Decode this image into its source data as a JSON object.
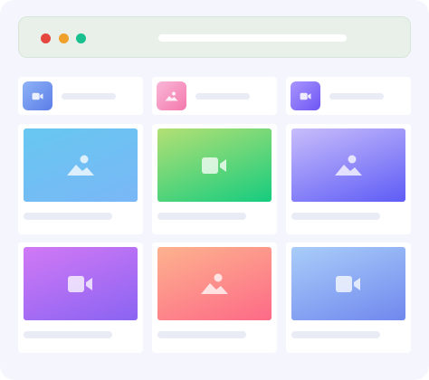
{
  "browser": {
    "traffic_lights": [
      "#e5463e",
      "#f0a12b",
      "#18c08f"
    ]
  },
  "header_cards": [
    {
      "icon": "video-icon",
      "gradient": [
        "#8fb3f7",
        "#5b7de8"
      ]
    },
    {
      "icon": "image-icon",
      "gradient": [
        "#f9b7d6",
        "#f478ad"
      ]
    },
    {
      "icon": "video-icon",
      "gradient": [
        "#a996ff",
        "#6d55f3"
      ]
    }
  ],
  "media_cards": [
    {
      "icon": "image-icon",
      "gradient": [
        "#67c7f1",
        "#7ab7f6"
      ]
    },
    {
      "icon": "video-icon",
      "gradient": [
        "#b3e074",
        "#16cc7f"
      ]
    },
    {
      "icon": "image-icon",
      "gradient": [
        "#c8bdfb",
        "#5e5cf6"
      ]
    },
    {
      "icon": "video-icon",
      "gradient": [
        "#d179f5",
        "#8a64f2"
      ]
    },
    {
      "icon": "image-icon",
      "gradient": [
        "#fdb28e",
        "#fd6a87"
      ]
    },
    {
      "icon": "video-icon",
      "gradient": [
        "#a9cdf9",
        "#7088ee"
      ]
    }
  ]
}
